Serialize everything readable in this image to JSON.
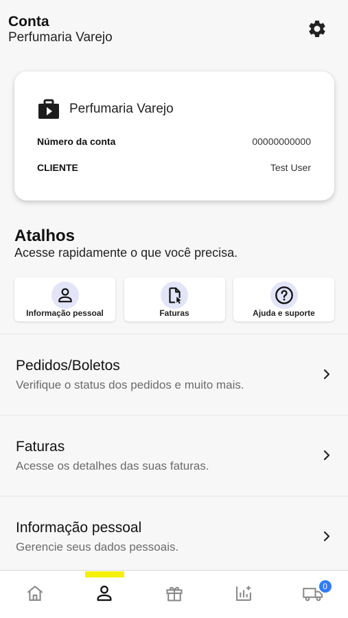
{
  "header": {
    "title": "Conta",
    "subtitle": "Perfumaria Varejo"
  },
  "account_card": {
    "business_name": "Perfumaria Varejo",
    "account_number_label": "Número da conta",
    "account_number_value": "00000000000",
    "client_label": "CLIENTE",
    "client_value": "Test User"
  },
  "shortcuts": {
    "title": "Atalhos",
    "subtitle": "Acesse rapidamente o que você precisa.",
    "items": [
      {
        "label": "Informação pessoal",
        "icon": "person-icon"
      },
      {
        "label": "Faturas",
        "icon": "invoice-icon"
      },
      {
        "label": "Ajuda e suporte",
        "icon": "help-icon"
      }
    ]
  },
  "menu": {
    "items": [
      {
        "title": "Pedidos/Boletos",
        "subtitle": "Verifique o status dos pedidos e muito mais."
      },
      {
        "title": "Faturas",
        "subtitle": "Acesse os detalhes das suas faturas."
      },
      {
        "title": "Informação pessoal",
        "subtitle": "Gerencie seus dados pessoais."
      }
    ]
  },
  "bottom_nav": {
    "tabs": [
      "home-icon",
      "account-icon",
      "gift-icon",
      "reports-icon",
      "delivery-truck-icon"
    ],
    "active_tab": "account-icon",
    "cart_count": "0"
  },
  "colors": {
    "accent_yellow": "#f4f00a",
    "badge_blue": "#2f7cf6",
    "icon_circle": "#e3e4f7"
  }
}
